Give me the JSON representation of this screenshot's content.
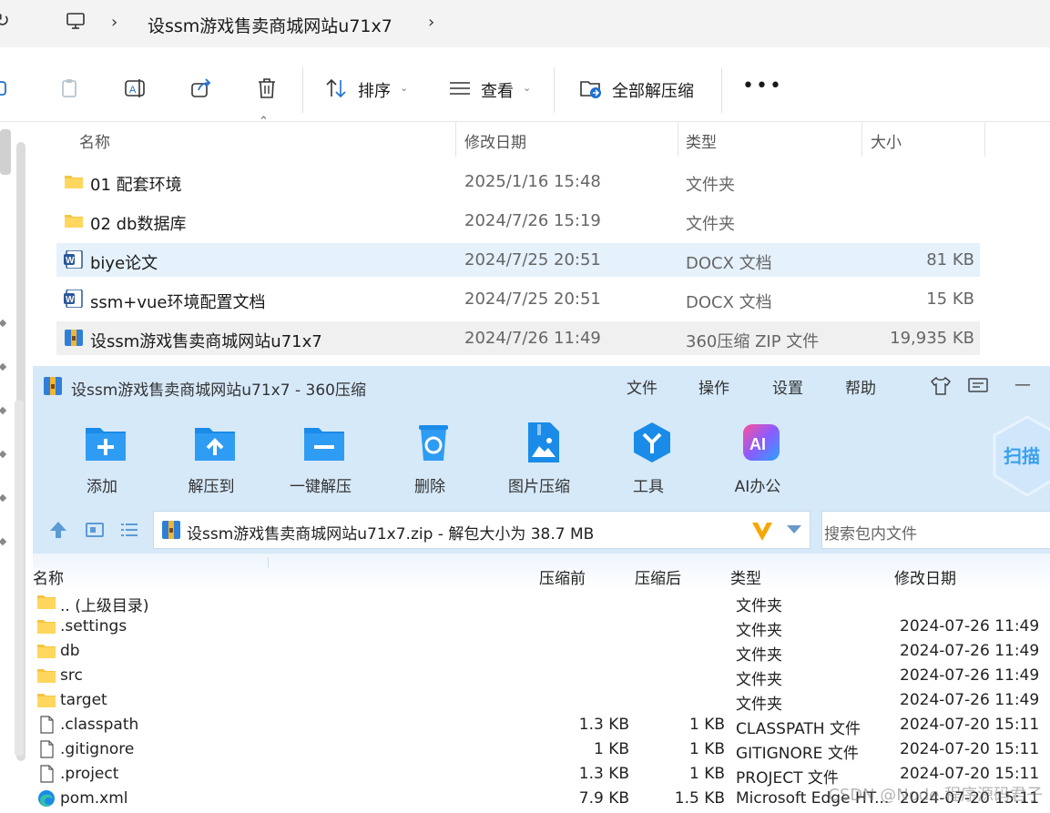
{
  "explorer": {
    "breadcrumb": {
      "current": "设ssm游戏售卖商城网站u71x7"
    },
    "toolbar": {
      "sort_label": "排序",
      "view_label": "查看",
      "extract_all_label": "全部解压缩"
    },
    "columns": {
      "name": "名称",
      "modified": "修改日期",
      "type": "类型",
      "size": "大小"
    },
    "files": [
      {
        "name": "01 配套环境",
        "modified": "2025/1/16 15:48",
        "type": "文件夹",
        "size": "",
        "icon": "folder-icon"
      },
      {
        "name": "02 db数据库",
        "modified": "2024/7/26 15:19",
        "type": "文件夹",
        "size": "",
        "icon": "folder-icon"
      },
      {
        "name": "biye论文",
        "modified": "2024/7/25 20:51",
        "type": "DOCX 文档",
        "size": "81 KB",
        "icon": "word-doc-icon"
      },
      {
        "name": "ssm+vue环境配置文档",
        "modified": "2024/7/25 20:51",
        "type": "DOCX 文档",
        "size": "15 KB",
        "icon": "word-doc-icon"
      },
      {
        "name": "设ssm游戏售卖商城网站u71x7",
        "modified": "2024/7/26 11:49",
        "type": "360压缩 ZIP 文件",
        "size": "19,935 KB",
        "icon": "zip-archive-icon"
      }
    ]
  },
  "zip": {
    "title": "设ssm游戏售卖商城网站u71x7 - 360压缩",
    "menu": [
      "文件",
      "操作",
      "设置",
      "帮助"
    ],
    "tools": [
      {
        "label": "添加",
        "icon": "add-folder-icon"
      },
      {
        "label": "解压到",
        "icon": "extract-to-icon"
      },
      {
        "label": "一键解压",
        "icon": "one-click-extract-icon"
      },
      {
        "label": "删除",
        "icon": "recycle-delete-icon"
      },
      {
        "label": "图片压缩",
        "icon": "image-compress-icon"
      },
      {
        "label": "工具",
        "icon": "tools-icon"
      },
      {
        "label": "AI办公",
        "icon": "ai-office-icon"
      }
    ],
    "scan_label": "扫描",
    "path": "设ssm游戏售卖商城网站u71x7.zip - 解包大小为 38.7 MB",
    "search_placeholder": "搜索包内文件",
    "columns": {
      "name": "名称",
      "compressed_before": "压缩前",
      "compressed_after": "压缩后",
      "type": "类型",
      "modified": "修改日期"
    },
    "entries": [
      {
        "name": ".. (上级目录)",
        "before": "",
        "after": "",
        "type": "文件夹",
        "modified": "",
        "icon": "folder-icon"
      },
      {
        "name": ".settings",
        "before": "",
        "after": "",
        "type": "文件夹",
        "modified": "2024-07-26 11:49",
        "icon": "folder-icon"
      },
      {
        "name": "db",
        "before": "",
        "after": "",
        "type": "文件夹",
        "modified": "2024-07-26 11:49",
        "icon": "folder-icon"
      },
      {
        "name": "src",
        "before": "",
        "after": "",
        "type": "文件夹",
        "modified": "2024-07-26 11:49",
        "icon": "folder-icon"
      },
      {
        "name": "target",
        "before": "",
        "after": "",
        "type": "文件夹",
        "modified": "2024-07-26 11:49",
        "icon": "folder-icon"
      },
      {
        "name": ".classpath",
        "before": "1.3 KB",
        "after": "1 KB",
        "type": "CLASSPATH 文件",
        "modified": "2024-07-20 15:11",
        "icon": "file-icon"
      },
      {
        "name": ".gitignore",
        "before": "1 KB",
        "after": "1 KB",
        "type": "GITIGNORE 文件",
        "modified": "2024-07-20 15:11",
        "icon": "file-icon"
      },
      {
        "name": ".project",
        "before": "1.3 KB",
        "after": "1 KB",
        "type": "PROJECT 文件",
        "modified": "2024-07-20 15:11",
        "icon": "file-icon"
      },
      {
        "name": "pom.xml",
        "before": "7.9 KB",
        "after": "1.5 KB",
        "type": "Microsoft Edge HT...",
        "modified": "2024-07-20 15:11",
        "icon": "edge-icon"
      }
    ]
  },
  "watermark": "CSDN @Node 程序源码君子",
  "colors": {
    "zip_chrome": "#d6e9f9",
    "selected_row": "#e5f1fb",
    "folder": "#f4c542",
    "accent_blue": "#1a8be8"
  }
}
